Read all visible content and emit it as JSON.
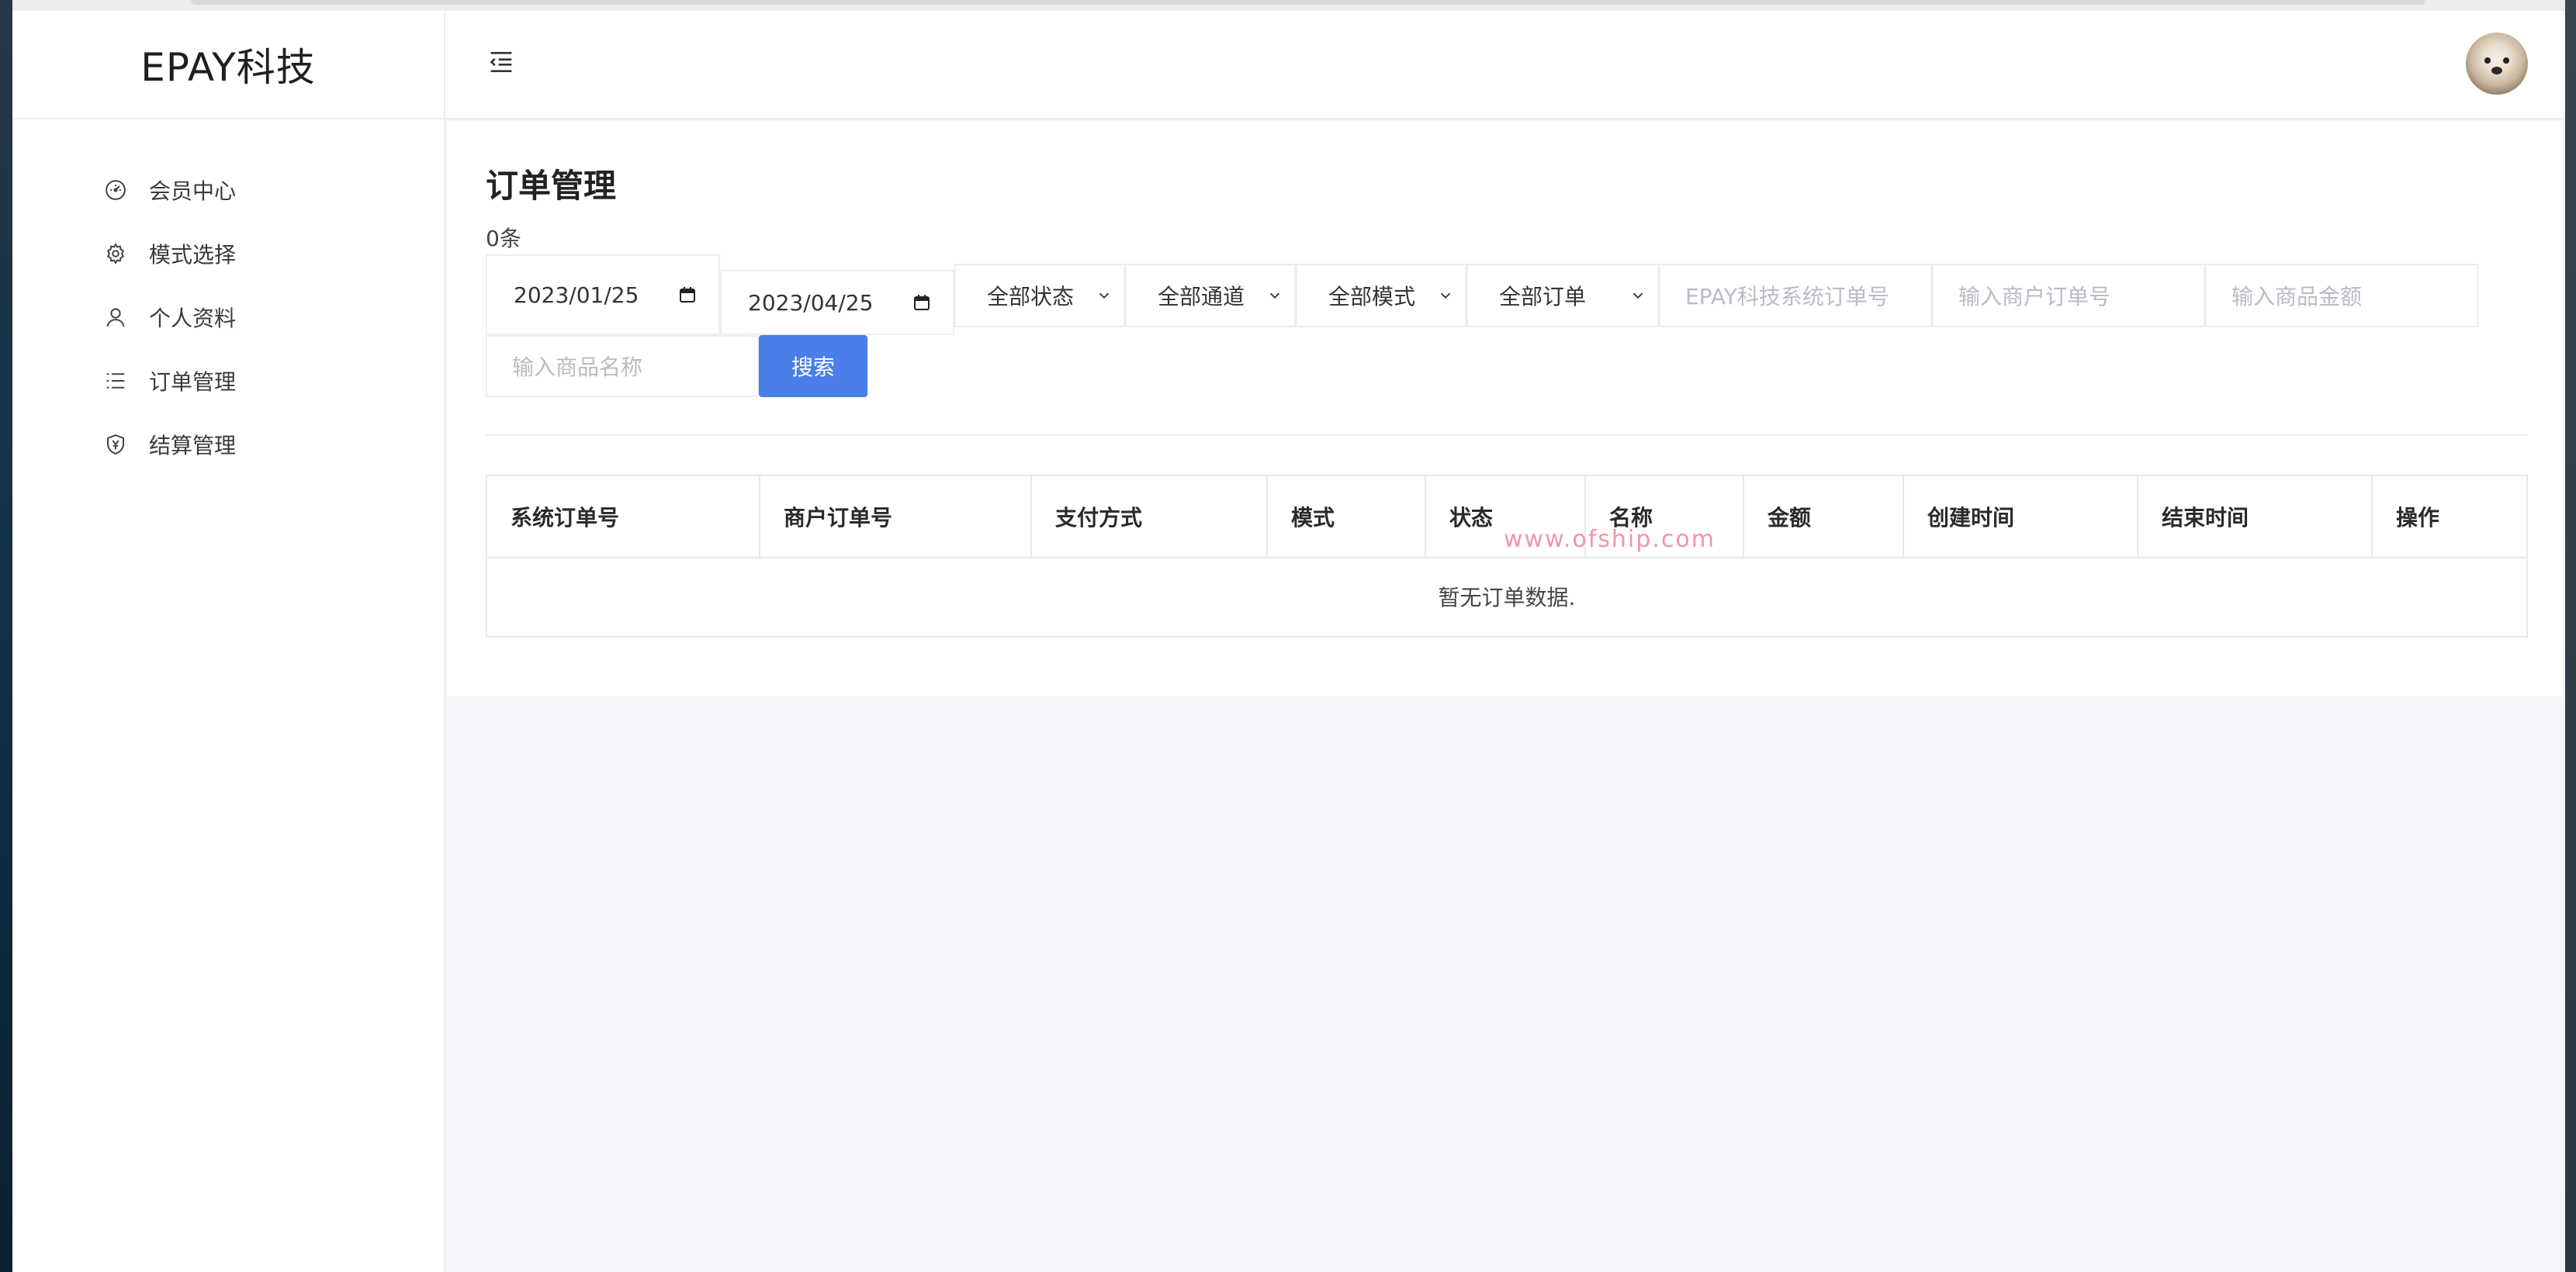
{
  "brand": {
    "name": "EPAY科技"
  },
  "sidebar": {
    "items": [
      {
        "label": "会员中心",
        "icon": "dashboard-icon"
      },
      {
        "label": "模式选择",
        "icon": "gear-icon"
      },
      {
        "label": "个人资料",
        "icon": "user-icon"
      },
      {
        "label": "订单管理",
        "icon": "list-icon"
      },
      {
        "label": "结算管理",
        "icon": "shield-yen-icon"
      }
    ]
  },
  "header": {
    "menu_icon": "menu-fold-icon",
    "avatar_icon": "avatar-dog"
  },
  "page": {
    "title": "订单管理",
    "count": "0条"
  },
  "filters": {
    "start_date": "2023/01/25",
    "end_date": "2023/04/25",
    "status": "全部状态",
    "channel": "全部通道",
    "mode": "全部模式",
    "order_type": "全部订单",
    "system_order_placeholder": "EPAY科技系统订单号",
    "merchant_order_placeholder": "输入商户订单号",
    "amount_placeholder": "输入商品金额",
    "product_name_placeholder": "输入商品名称",
    "search_label": "搜索"
  },
  "table": {
    "headers": [
      "系统订单号",
      "商户订单号",
      "支付方式",
      "模式",
      "状态",
      "名称",
      "金额",
      "创建时间",
      "结束时间",
      "操作"
    ],
    "empty_text": "暂无订单数据."
  },
  "watermark": "www.ofship.com",
  "colors": {
    "primary": "#4a7ee8",
    "background": "#f4f6fb",
    "border": "#ebedf2"
  }
}
